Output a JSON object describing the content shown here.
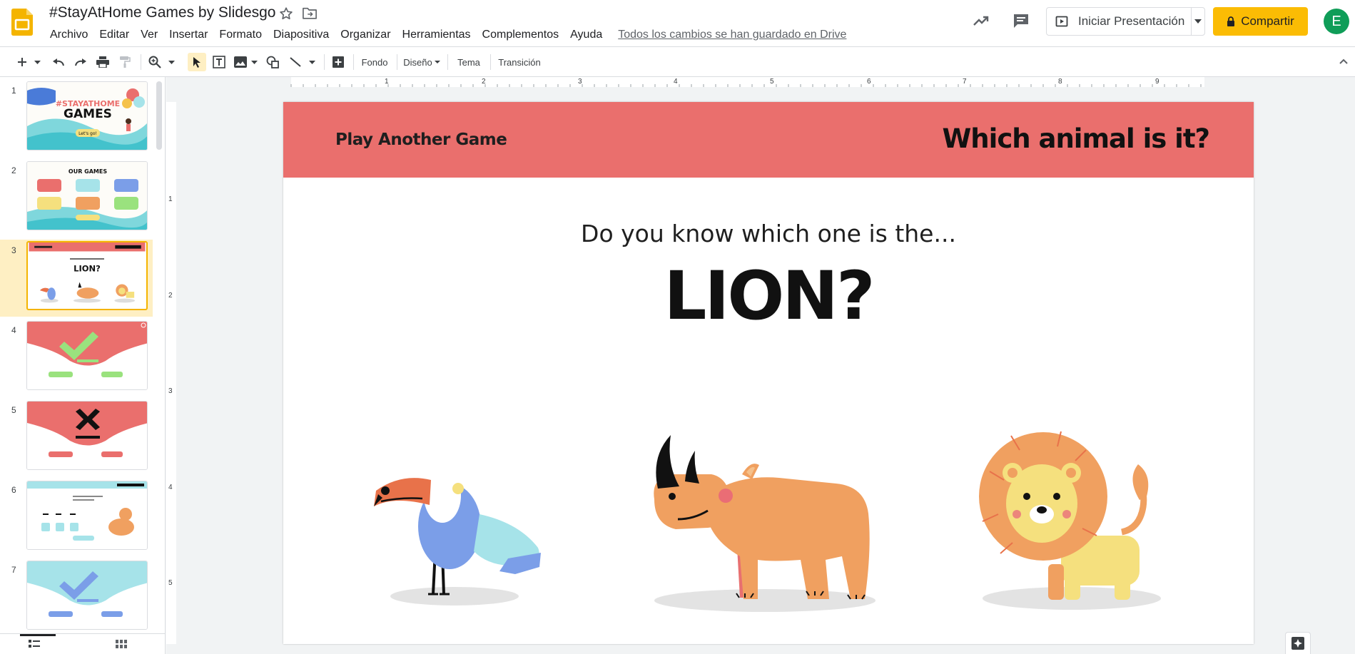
{
  "app": {
    "doc_title": "#StayAtHome Games by Slidesgo",
    "menus": [
      "Archivo",
      "Editar",
      "Ver",
      "Insertar",
      "Formato",
      "Diapositiva",
      "Organizar",
      "Herramientas",
      "Complementos",
      "Ayuda"
    ],
    "saved_status": "Todos los cambios se han guardado en Drive",
    "present_label": "Iniciar Presentación",
    "share_label": "Compartir",
    "avatar_initial": "E"
  },
  "toolbar": {
    "background_label": "Fondo",
    "layout_label": "Diseño",
    "theme_label": "Tema",
    "transition_label": "Transición"
  },
  "ruler": {
    "top": [
      "1",
      "2",
      "3",
      "4",
      "5",
      "6",
      "7",
      "8",
      "9"
    ],
    "left": [
      "1",
      "2",
      "3",
      "4",
      "5"
    ]
  },
  "filmstrip": {
    "slide_numbers": [
      "1",
      "2",
      "3",
      "4",
      "5",
      "6",
      "7"
    ],
    "active_slide": 3
  },
  "slide": {
    "banner_left": "Play Another Game",
    "banner_right": "Which animal is it?",
    "question": "Do you know which one is the...",
    "answer": "LION?",
    "banner_color": "#ea6f6d"
  },
  "colors": {
    "accent": "#fbbc04",
    "selected_thumb": "#feefc3",
    "avatar_bg": "#0f9d58"
  },
  "icons": {
    "app_logo": "slides-logo-icon",
    "star": "star-icon",
    "move": "folder-move-icon",
    "activity": "trending-up-icon",
    "comments": "comment-icon",
    "lock": "lock-icon"
  }
}
